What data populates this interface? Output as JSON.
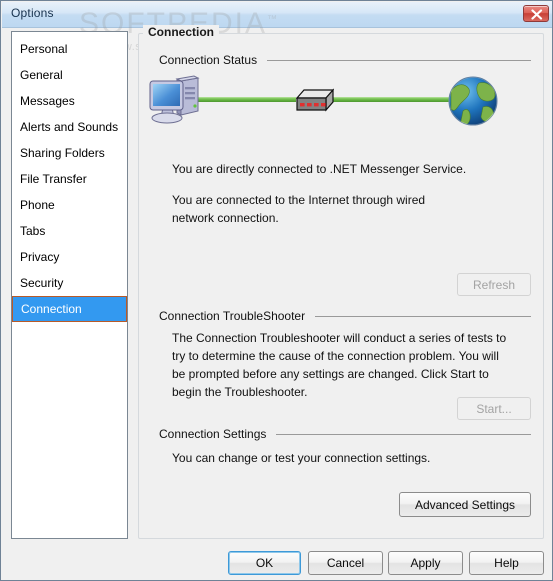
{
  "window": {
    "title": "Options",
    "close_icon": "close-icon",
    "border_color": "#6f8296",
    "titlebar_color": "#c4dcf2"
  },
  "watermark": {
    "text": "SOFTPEDIA",
    "trademark": "™",
    "url": "www.softpedia.com"
  },
  "sidebar": {
    "items": [
      {
        "label": "Personal",
        "selected": false
      },
      {
        "label": "General",
        "selected": false
      },
      {
        "label": "Messages",
        "selected": false
      },
      {
        "label": "Alerts and Sounds",
        "selected": false
      },
      {
        "label": "Sharing Folders",
        "selected": false
      },
      {
        "label": "File Transfer",
        "selected": false
      },
      {
        "label": "Phone",
        "selected": false
      },
      {
        "label": "Tabs",
        "selected": false
      },
      {
        "label": "Privacy",
        "selected": false
      },
      {
        "label": "Security",
        "selected": false
      },
      {
        "label": "Connection",
        "selected": true
      }
    ],
    "selected_bg": "#3399f0",
    "selected_border": "#b85a28"
  },
  "main": {
    "group_title": "Connection",
    "sections": {
      "status": {
        "header": "Connection Status",
        "diagram": {
          "computer_icon": "computer-icon",
          "router_icon": "router-icon",
          "globe_icon": "globe-icon",
          "link_color": "#63b33f",
          "led_color": "#e03030",
          "led_count": 4
        },
        "line1": "You are directly connected to .NET Messenger Service.",
        "line2": "You are connected to the Internet through wired network connection.",
        "refresh_button": "Refresh",
        "refresh_enabled": false
      },
      "troubleshooter": {
        "header": "Connection TroubleShooter",
        "body": "The Connection Troubleshooter will conduct a series of tests to try to determine the cause of the connection problem. You will be prompted before any settings are changed. Click Start to begin the Troubleshooter.",
        "start_button": "Start...",
        "start_enabled": false
      },
      "settings": {
        "header": "Connection Settings",
        "body": "You can change or test your connection settings.",
        "advanced_button": "Advanced Settings",
        "advanced_enabled": true
      }
    }
  },
  "footer": {
    "ok": "OK",
    "cancel": "Cancel",
    "apply": "Apply",
    "help": "Help"
  }
}
